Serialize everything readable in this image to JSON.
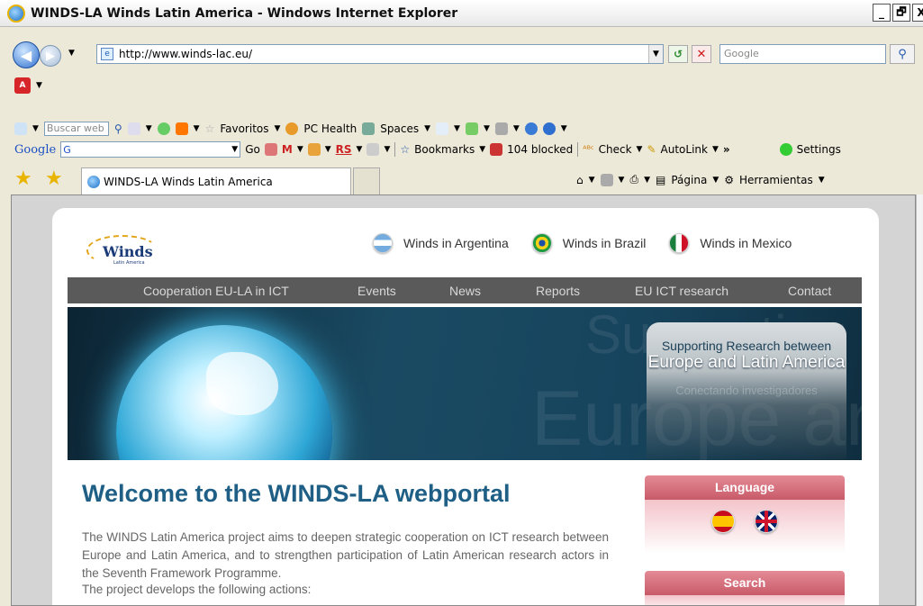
{
  "window": {
    "title": "WINDS-LA Winds Latin America - Windows Internet Explorer",
    "min": "_",
    "max": "🗗",
    "close": "X"
  },
  "addressbar": {
    "url": "http://www.winds-lac.eu/",
    "search_placeholder": "Google"
  },
  "toolbar1": {
    "search_placeholder": "Buscar web",
    "favoritos": "Favoritos",
    "pc_health": "PC Health",
    "spaces": "Spaces"
  },
  "toolbar2": {
    "google_logo": "Google",
    "google_box": "G",
    "go": "Go",
    "rs": "RS",
    "bookmarks": "Bookmarks",
    "blocked": "104 blocked",
    "check": "Check",
    "autolink": "AutoLink",
    "more": "»",
    "settings": "Settings"
  },
  "tabs": {
    "active_tab": "WINDS-LA Winds Latin America",
    "pagina": "Página",
    "herramientas": "Herramientas"
  },
  "site": {
    "logo_text": "Winds",
    "logo_sub": "Latin America",
    "countries": [
      {
        "label": "Winds in Argentina"
      },
      {
        "label": "Winds in Brazil"
      },
      {
        "label": "Winds in Mexico"
      }
    ],
    "nav": [
      {
        "label": "Cooperation EU-LA in ICT"
      },
      {
        "label": "Events"
      },
      {
        "label": "News"
      },
      {
        "label": "Reports"
      },
      {
        "label": "EU ICT research"
      },
      {
        "label": "Contact"
      }
    ],
    "banner": {
      "line1": "Supporting Research between",
      "line2": "Europe and Latin America",
      "line3": "Conectando investigadores",
      "bg1": "Supporting",
      "bg2": "Europe and"
    },
    "welcome_title": "Welcome to the WINDS-LA webportal",
    "intro": "The WINDS Latin America project aims to deepen strategic cooperation on ICT research between Europe and Latin America, and to strengthen participation of Latin American research actors in the Seventh Framework Programme.",
    "intro2": "The project develops the following actions:",
    "language_title": "Language",
    "search_title": "Search"
  }
}
